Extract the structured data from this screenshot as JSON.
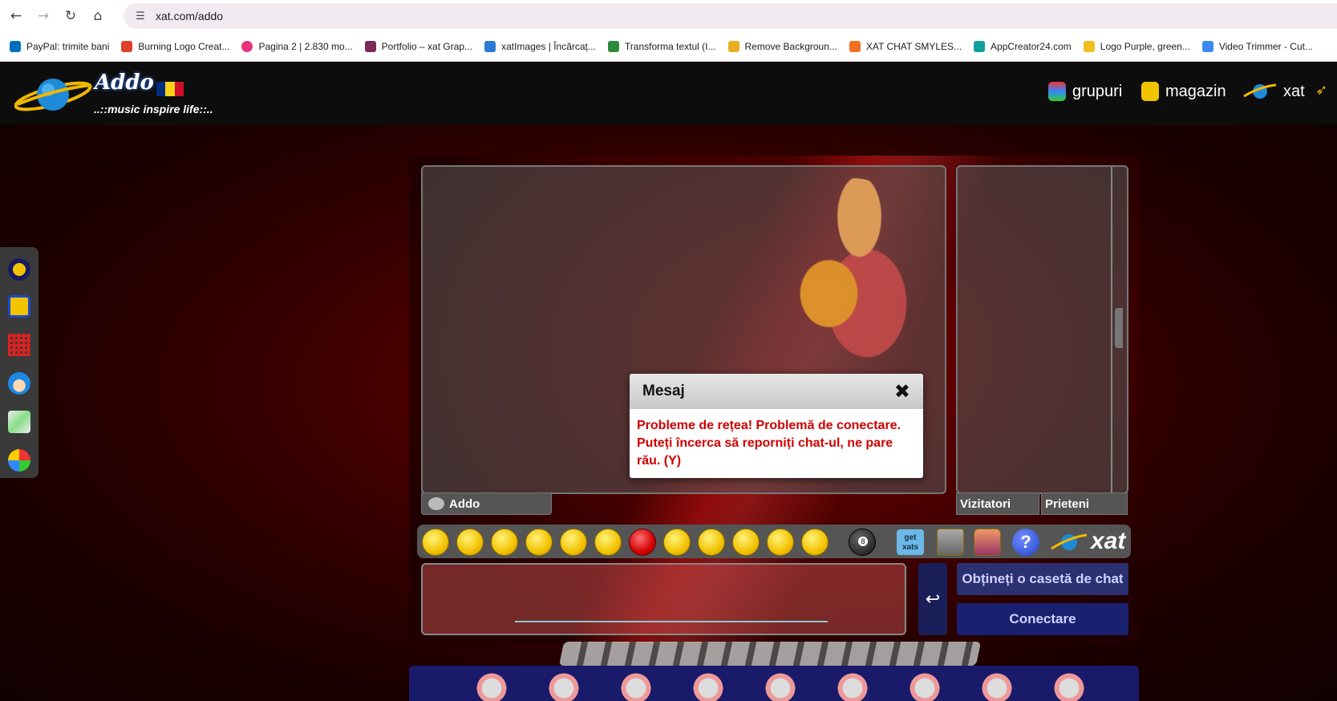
{
  "browser": {
    "url": "xat.com/addo",
    "bookmarks": [
      {
        "label": "PayPal: trimite bani",
        "color": "#0070ba"
      },
      {
        "label": "Burning Logo Creat...",
        "color": "#e0402a"
      },
      {
        "label": "Pagina 2 | 2.830 mo...",
        "color": "#e8317a"
      },
      {
        "label": "Portfolio – xat Grap...",
        "color": "#7a2a5a"
      },
      {
        "label": "xatImages | Încărcaț...",
        "color": "#2a7ad0"
      },
      {
        "label": "Transforma textul (I...",
        "color": "#2a8a3a"
      },
      {
        "label": "Remove Backgroun...",
        "color": "#e8b020"
      },
      {
        "label": "XAT CHAT SMYLES...",
        "color": "#f07020"
      },
      {
        "label": "AppCreator24.com",
        "color": "#10a0a0"
      },
      {
        "label": "Logo Purple, green...",
        "color": "#f0c020"
      },
      {
        "label": "Video Trimmer - Cut...",
        "color": "#3a8af0"
      }
    ]
  },
  "header": {
    "title": "Addo",
    "subtitle": "..::music inspire life::..",
    "nav": [
      {
        "label": "grupuri",
        "icon": "groups-icon"
      },
      {
        "label": "magazin",
        "icon": "shop-bag-icon"
      },
      {
        "label": "xat",
        "icon": "xat-planet-icon"
      }
    ]
  },
  "chat": {
    "tab_main": "Addo",
    "tab_visitors": "Vizitatori",
    "tab_friends": "Prieteni",
    "get_xats": "get xats",
    "help": "?",
    "brand": "xat",
    "send_symbol": "↩",
    "get_chat_box": "Obțineți o casetă de chat",
    "connect": "Conectare"
  },
  "dialog": {
    "title": "Mesaj",
    "close": "✖",
    "message": "Probleme de rețea! Problemă de conectare. Puteți încerca să reporniți chat-ul, ne pare rău. (Y)"
  },
  "colors": {
    "accent_red": "#d00000",
    "button_navy": "#1a2070",
    "header_bg": "#0d0d0d"
  }
}
